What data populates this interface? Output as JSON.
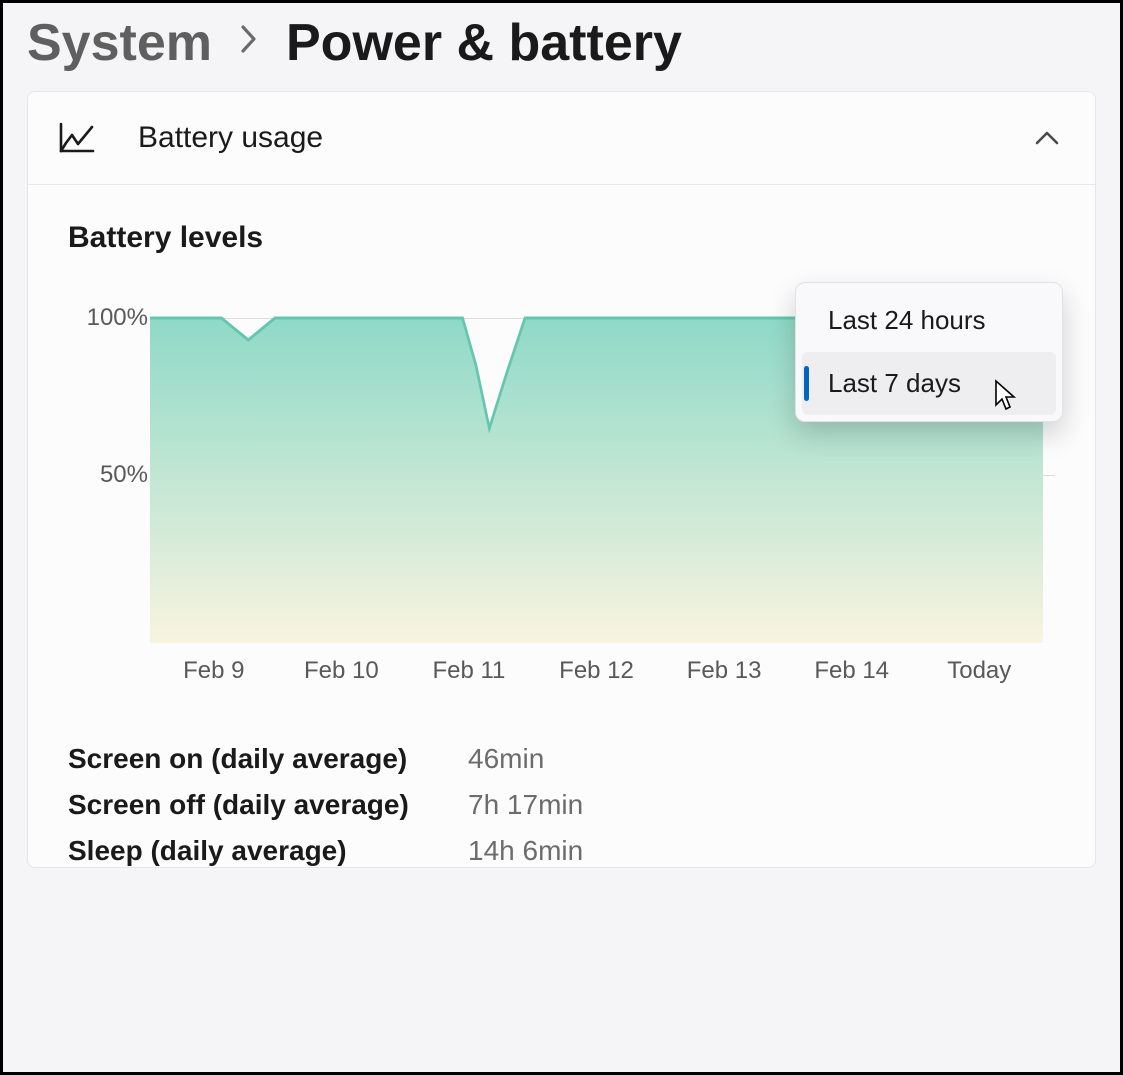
{
  "breadcrumb": {
    "parent": "System",
    "current": "Power & battery"
  },
  "card": {
    "title": "Battery usage",
    "section_title": "Battery levels"
  },
  "dropdown": {
    "options": [
      "Last 24 hours",
      "Last 7 days"
    ],
    "selected_index": 1
  },
  "stats": [
    {
      "label": "Screen on (daily average)",
      "value": "46min"
    },
    {
      "label": "Screen off (daily average)",
      "value": "7h 17min"
    },
    {
      "label": "Sleep (daily average)",
      "value": "14h 6min"
    }
  ],
  "chart_data": {
    "type": "area",
    "title": "Battery levels",
    "xlabel": "",
    "ylabel": "",
    "ylim": [
      0,
      100
    ],
    "y_ticks": [
      50,
      100
    ],
    "y_tick_labels": [
      "50%",
      "100%"
    ],
    "categories": [
      "Feb 9",
      "Feb 10",
      "Feb 11",
      "Feb 12",
      "Feb 13",
      "Feb 14",
      "Today"
    ],
    "x": [
      0.0,
      0.08,
      0.11,
      0.14,
      0.35,
      0.365,
      0.38,
      0.4,
      0.42,
      0.8,
      0.815,
      0.83,
      0.86,
      0.875,
      0.89,
      0.975,
      0.99,
      1.0
    ],
    "values": [
      100,
      100,
      93,
      100,
      100,
      85,
      65,
      83,
      100,
      100,
      85,
      78,
      78,
      84,
      100,
      100,
      95,
      90
    ],
    "fill_gradient": [
      "#8fd9c8",
      "#f8f4e0"
    ],
    "stroke": "#63c7b0"
  }
}
